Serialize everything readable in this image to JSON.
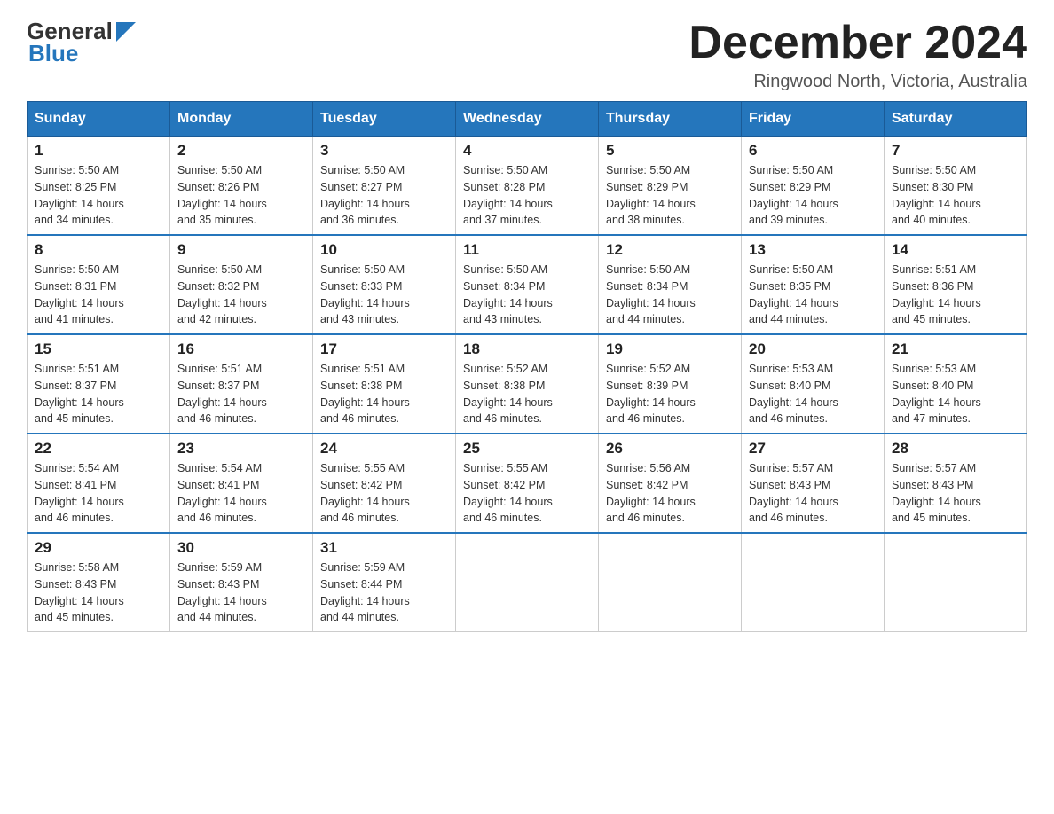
{
  "header": {
    "title": "December 2024",
    "subtitle": "Ringwood North, Victoria, Australia",
    "logo_general": "General",
    "logo_blue": "Blue"
  },
  "days_of_week": [
    "Sunday",
    "Monday",
    "Tuesday",
    "Wednesday",
    "Thursday",
    "Friday",
    "Saturday"
  ],
  "weeks": [
    [
      {
        "day": "1",
        "sunrise": "5:50 AM",
        "sunset": "8:25 PM",
        "daylight": "14 hours and 34 minutes."
      },
      {
        "day": "2",
        "sunrise": "5:50 AM",
        "sunset": "8:26 PM",
        "daylight": "14 hours and 35 minutes."
      },
      {
        "day": "3",
        "sunrise": "5:50 AM",
        "sunset": "8:27 PM",
        "daylight": "14 hours and 36 minutes."
      },
      {
        "day": "4",
        "sunrise": "5:50 AM",
        "sunset": "8:28 PM",
        "daylight": "14 hours and 37 minutes."
      },
      {
        "day": "5",
        "sunrise": "5:50 AM",
        "sunset": "8:29 PM",
        "daylight": "14 hours and 38 minutes."
      },
      {
        "day": "6",
        "sunrise": "5:50 AM",
        "sunset": "8:29 PM",
        "daylight": "14 hours and 39 minutes."
      },
      {
        "day": "7",
        "sunrise": "5:50 AM",
        "sunset": "8:30 PM",
        "daylight": "14 hours and 40 minutes."
      }
    ],
    [
      {
        "day": "8",
        "sunrise": "5:50 AM",
        "sunset": "8:31 PM",
        "daylight": "14 hours and 41 minutes."
      },
      {
        "day": "9",
        "sunrise": "5:50 AM",
        "sunset": "8:32 PM",
        "daylight": "14 hours and 42 minutes."
      },
      {
        "day": "10",
        "sunrise": "5:50 AM",
        "sunset": "8:33 PM",
        "daylight": "14 hours and 43 minutes."
      },
      {
        "day": "11",
        "sunrise": "5:50 AM",
        "sunset": "8:34 PM",
        "daylight": "14 hours and 43 minutes."
      },
      {
        "day": "12",
        "sunrise": "5:50 AM",
        "sunset": "8:34 PM",
        "daylight": "14 hours and 44 minutes."
      },
      {
        "day": "13",
        "sunrise": "5:50 AM",
        "sunset": "8:35 PM",
        "daylight": "14 hours and 44 minutes."
      },
      {
        "day": "14",
        "sunrise": "5:51 AM",
        "sunset": "8:36 PM",
        "daylight": "14 hours and 45 minutes."
      }
    ],
    [
      {
        "day": "15",
        "sunrise": "5:51 AM",
        "sunset": "8:37 PM",
        "daylight": "14 hours and 45 minutes."
      },
      {
        "day": "16",
        "sunrise": "5:51 AM",
        "sunset": "8:37 PM",
        "daylight": "14 hours and 46 minutes."
      },
      {
        "day": "17",
        "sunrise": "5:51 AM",
        "sunset": "8:38 PM",
        "daylight": "14 hours and 46 minutes."
      },
      {
        "day": "18",
        "sunrise": "5:52 AM",
        "sunset": "8:38 PM",
        "daylight": "14 hours and 46 minutes."
      },
      {
        "day": "19",
        "sunrise": "5:52 AM",
        "sunset": "8:39 PM",
        "daylight": "14 hours and 46 minutes."
      },
      {
        "day": "20",
        "sunrise": "5:53 AM",
        "sunset": "8:40 PM",
        "daylight": "14 hours and 46 minutes."
      },
      {
        "day": "21",
        "sunrise": "5:53 AM",
        "sunset": "8:40 PM",
        "daylight": "14 hours and 47 minutes."
      }
    ],
    [
      {
        "day": "22",
        "sunrise": "5:54 AM",
        "sunset": "8:41 PM",
        "daylight": "14 hours and 46 minutes."
      },
      {
        "day": "23",
        "sunrise": "5:54 AM",
        "sunset": "8:41 PM",
        "daylight": "14 hours and 46 minutes."
      },
      {
        "day": "24",
        "sunrise": "5:55 AM",
        "sunset": "8:42 PM",
        "daylight": "14 hours and 46 minutes."
      },
      {
        "day": "25",
        "sunrise": "5:55 AM",
        "sunset": "8:42 PM",
        "daylight": "14 hours and 46 minutes."
      },
      {
        "day": "26",
        "sunrise": "5:56 AM",
        "sunset": "8:42 PM",
        "daylight": "14 hours and 46 minutes."
      },
      {
        "day": "27",
        "sunrise": "5:57 AM",
        "sunset": "8:43 PM",
        "daylight": "14 hours and 46 minutes."
      },
      {
        "day": "28",
        "sunrise": "5:57 AM",
        "sunset": "8:43 PM",
        "daylight": "14 hours and 45 minutes."
      }
    ],
    [
      {
        "day": "29",
        "sunrise": "5:58 AM",
        "sunset": "8:43 PM",
        "daylight": "14 hours and 45 minutes."
      },
      {
        "day": "30",
        "sunrise": "5:59 AM",
        "sunset": "8:43 PM",
        "daylight": "14 hours and 44 minutes."
      },
      {
        "day": "31",
        "sunrise": "5:59 AM",
        "sunset": "8:44 PM",
        "daylight": "14 hours and 44 minutes."
      },
      null,
      null,
      null,
      null
    ]
  ],
  "labels": {
    "sunrise": "Sunrise:",
    "sunset": "Sunset:",
    "daylight": "Daylight:"
  }
}
